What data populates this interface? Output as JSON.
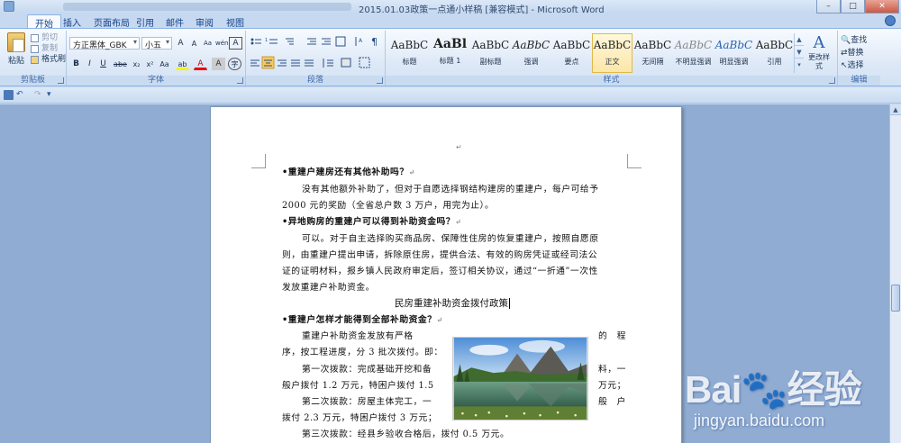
{
  "window": {
    "title": "2015.01.03政策一点通小样稿 [兼容模式] - Microsoft Word",
    "buttons": {
      "minimize": "–",
      "maximize": "□",
      "close": "✕"
    }
  },
  "tabs": [
    "开始",
    "插入",
    "页面布局",
    "引用",
    "邮件",
    "审阅",
    "视图"
  ],
  "ribbon": {
    "clipboard": {
      "paste": "粘贴",
      "cut": "剪切",
      "copy": "复制",
      "format_painter": "格式刷",
      "label": "剪贴板"
    },
    "font": {
      "name": "方正黑体_GBK",
      "size": "小五",
      "grow": "A",
      "shrink": "A",
      "clear": "Aa",
      "phonetic": "wén",
      "border_char": "A",
      "bold": "B",
      "italic": "I",
      "underline": "U",
      "strike": "abe",
      "sub": "x₂",
      "sup": "x²",
      "change_case": "Aa",
      "highlight": "ab",
      "font_color": "A",
      "shade_char": "A",
      "enclose": "字",
      "label": "字体"
    },
    "paragraph": {
      "label": "段落"
    },
    "styles": {
      "items": [
        {
          "sample": "AaBbC",
          "name": "标题"
        },
        {
          "sample": "AaBl",
          "name": "标题 1"
        },
        {
          "sample": "AaBbC",
          "name": "副标题"
        },
        {
          "sample": "AaBbC",
          "name": "强调"
        },
        {
          "sample": "AaBbC",
          "name": "要点"
        },
        {
          "sample": "AaBbC",
          "name": "正文"
        },
        {
          "sample": "AaBbC",
          "name": "无间隔"
        },
        {
          "sample": "AaBbC",
          "name": "不明显强调"
        },
        {
          "sample": "AaBbC",
          "name": "明显强调"
        },
        {
          "sample": "AaBbC",
          "name": "引用"
        }
      ],
      "change_styles": "更改样式",
      "label": "样式"
    },
    "editing": {
      "find": "查找",
      "replace": "替换",
      "select": "选择",
      "label": "编辑"
    }
  },
  "document": {
    "q1": "重建户建房还有其他补助吗？",
    "p1": [
      "没有其他额外补助了，但对于自愿选择钢结构建房的重建户，每户可给予",
      "2000 元的奖励（全省总户数 3 万户，用完为止）。"
    ],
    "q2": "异地购房的重建户可以得到补助资金吗？",
    "p2": [
      "可以。对于自主选择购买商品房、保障性住房的恢复重建户，按照自愿原",
      "则，由重建户提出申请，拆除原住房，提供合法、有效的购房凭证或经司法公",
      "证的证明材料，报乡镇人民政府审定后，签订相关协议，通过“一折通”一次性",
      "发放重建户补助资金。"
    ],
    "section_title": "民房重建补助资金拨付政策",
    "q3": "重建户怎样才能得到全部补助资金？",
    "p3_left": [
      "重建户补助资金发放有严格",
      "序，按工程进度，分 3 批次拨付。即：",
      "第一次拨款：完成基础开挖和备",
      "般户拨付 1.2 万元，特困户拨付 1.5",
      "第二次拨款：房屋主体完工，一",
      "拨付 2.3 万元，特困户拨付 3 万元；",
      "第三次拨款：经县乡验收合格后，拨付 0.5 万元。"
    ],
    "p3_right": [
      "的　程",
      "",
      "料，一",
      "万元；",
      "般　户"
    ]
  },
  "watermark": {
    "logo": "Bai🐾经验",
    "url": "jingyan.baidu.com"
  }
}
